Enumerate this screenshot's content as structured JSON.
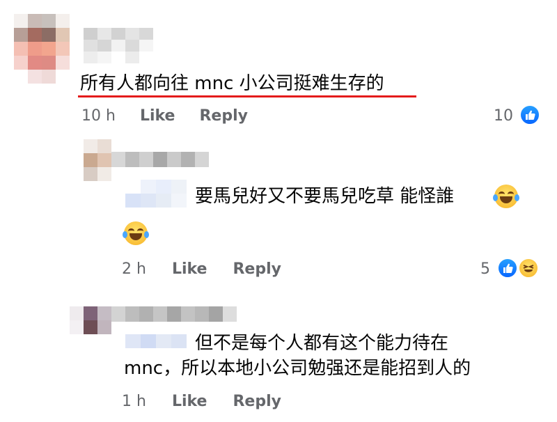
{
  "comment1": {
    "text": "所有人都向往 mnc 小公司挺难生存的",
    "time": "10 h",
    "like_label": "Like",
    "reply_label": "Reply",
    "reaction_count": "10",
    "reactions": [
      "like-icon"
    ]
  },
  "reply1": {
    "text_line1": "要馬兒好又不要馬兒吃草 能怪誰",
    "emojis": [
      "laughing-tears-emoji",
      "laughing-tears-emoji"
    ],
    "time": "2 h",
    "like_label": "Like",
    "reply_label": "Reply",
    "reaction_count": "5",
    "reactions": [
      "like-icon",
      "haha-icon"
    ]
  },
  "reply2": {
    "text_line1": "但不是每个人都有这个能力待在",
    "text_line2": "mnc，所以本地小公司勉强还是能招到人的",
    "time": "1 h",
    "like_label": "Like",
    "reply_label": "Reply"
  },
  "colors": {
    "underline": "#e41b1b",
    "meta_text": "#65676b",
    "like_blue": "#0866ff"
  }
}
